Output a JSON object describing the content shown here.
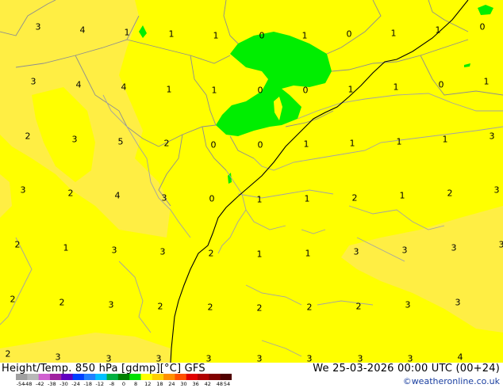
{
  "map": {
    "background_color": "#ffff00",
    "shading_light_color": "#ffee44",
    "positive_area_color": "#00ee00",
    "border_color": "#909090",
    "coast_color": "#a0a0a0",
    "isoline_color": "#000000"
  },
  "grid_values": [
    {
      "v": "3"
    },
    {
      "v": "4"
    },
    {
      "v": "1"
    },
    {
      "v": "1"
    },
    {
      "v": "1"
    },
    {
      "v": "0"
    },
    {
      "v": "1"
    },
    {
      "v": "0"
    },
    {
      "v": "1"
    },
    {
      "v": "1"
    },
    {
      "v": "0"
    },
    {
      "v": "3"
    },
    {
      "v": "4"
    },
    {
      "v": "4"
    },
    {
      "v": "1"
    },
    {
      "v": "1"
    },
    {
      "v": "0"
    },
    {
      "v": "0"
    },
    {
      "v": "1"
    },
    {
      "v": "1"
    },
    {
      "v": "0"
    },
    {
      "v": "1"
    },
    {
      "v": "2"
    },
    {
      "v": "3"
    },
    {
      "v": "5"
    },
    {
      "v": "2"
    },
    {
      "v": "0"
    },
    {
      "v": "0"
    },
    {
      "v": "1"
    },
    {
      "v": "1"
    },
    {
      "v": "1"
    },
    {
      "v": "1"
    },
    {
      "v": "3"
    },
    {
      "v": "3"
    },
    {
      "v": "2"
    },
    {
      "v": "4"
    },
    {
      "v": "3"
    },
    {
      "v": "0"
    },
    {
      "v": "1"
    },
    {
      "v": "1"
    },
    {
      "v": "2"
    },
    {
      "v": "1"
    },
    {
      "v": "2"
    },
    {
      "v": "3"
    },
    {
      "v": "2"
    },
    {
      "v": "1"
    },
    {
      "v": "3"
    },
    {
      "v": "3"
    },
    {
      "v": "2"
    },
    {
      "v": "1"
    },
    {
      "v": "1"
    },
    {
      "v": "3"
    },
    {
      "v": "3"
    },
    {
      "v": "3"
    },
    {
      "v": "3"
    },
    {
      "v": "2"
    },
    {
      "v": "2"
    },
    {
      "v": "3"
    },
    {
      "v": "2"
    },
    {
      "v": "2"
    },
    {
      "v": "2"
    },
    {
      "v": "2"
    },
    {
      "v": "2"
    },
    {
      "v": "3"
    },
    {
      "v": "3"
    },
    {
      "v": "2"
    },
    {
      "v": "3"
    },
    {
      "v": "3"
    },
    {
      "v": "3"
    },
    {
      "v": "3"
    },
    {
      "v": "3"
    },
    {
      "v": "3"
    },
    {
      "v": "3"
    },
    {
      "v": "3"
    },
    {
      "v": "4"
    }
  ],
  "footer": {
    "title": "Height/Temp. 850 hPa [gdmp][°C] GFS",
    "datetime": "We 25-03-2026 00:00 UTC (00+24)",
    "credit": "©weatheronline.co.uk"
  },
  "legend": {
    "ticks": [
      "-54",
      "-48",
      "-42",
      "-38",
      "-30",
      "-24",
      "-18",
      "-12",
      "-8",
      "0",
      "8",
      "12",
      "18",
      "24",
      "30",
      "36",
      "42",
      "48",
      "54"
    ],
    "colors": [
      "#a0a0a0",
      "#b8b8b8",
      "#d060d0",
      "#a020a0",
      "#6000c0",
      "#0040ff",
      "#2080ff",
      "#00c0ff",
      "#00b040",
      "#008000",
      "#00e000",
      "#ffff00",
      "#ffd000",
      "#ff9000",
      "#ff5000",
      "#e00000",
      "#b00000",
      "#800000",
      "#500000"
    ]
  }
}
